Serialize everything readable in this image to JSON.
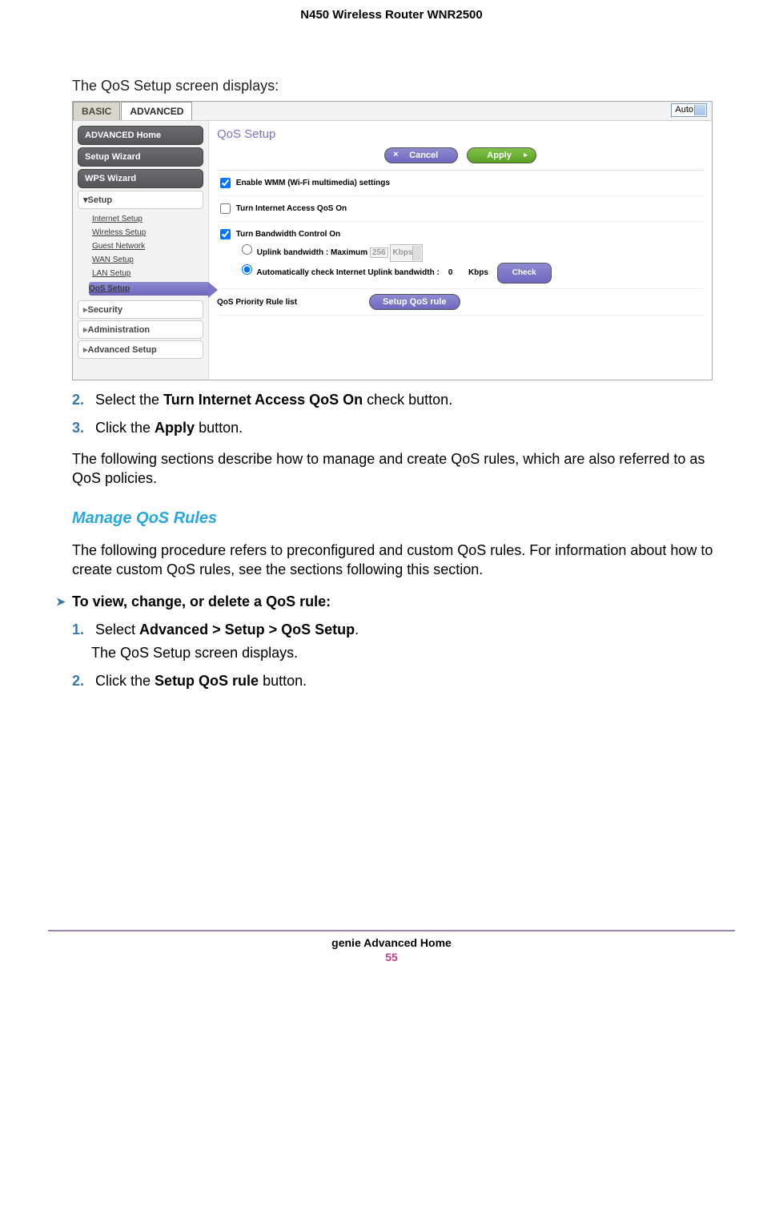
{
  "doc_header": "N450 Wireless Router WNR2500",
  "intro": "The QoS Setup screen displays:",
  "shot": {
    "tabs": {
      "basic": "BASIC",
      "advanced": "ADVANCED"
    },
    "auto_dd": "Auto",
    "sidebar": {
      "adv_home": "ADVANCED Home",
      "setup_wiz": "Setup Wizard",
      "wps_wiz": "WPS Wizard",
      "setup": "Setup",
      "sub": {
        "internet": "Internet Setup",
        "wireless": "Wireless Setup",
        "guest": "Guest Network",
        "wan": "WAN Setup",
        "lan": "LAN Setup",
        "qos": "QoS Setup"
      },
      "security": "Security",
      "admin": "Administration",
      "advsetup": "Advanced Setup"
    },
    "content": {
      "title": "QoS Setup",
      "cancel": "Cancel",
      "apply": "Apply",
      "wmm": "Enable WMM (Wi-Fi multimedia) settings",
      "internet_qos": "Turn Internet Access QoS On",
      "bw_ctrl": "Turn Bandwidth Control On",
      "uplink_label": "Uplink bandwidth :   Maximum",
      "uplink_val": "256",
      "uplink_unit": "Kbps",
      "auto_check_label": "Automatically check Internet Uplink bandwidth :",
      "auto_check_val": "0",
      "auto_check_unit": "Kbps",
      "check_btn": "Check",
      "rule_list": "QoS Priority Rule list",
      "setup_rule_btn": "Setup QoS rule"
    }
  },
  "steps_a": {
    "n2_pre": "Select the ",
    "n2_bold": "Turn Internet Access QoS On",
    "n2_post": " check button.",
    "n3_pre": "Click the ",
    "n3_bold": "Apply",
    "n3_post": " button."
  },
  "para1": "The following sections describe how to manage and create QoS rules, which are also referred to as QoS policies.",
  "h3": "Manage QoS Rules",
  "para2": "The following procedure refers to preconfigured and custom QoS rules. For information about how to create custom QoS rules, see the sections following this section.",
  "proc_head": "To view, change, or delete a QoS rule:",
  "steps_b": {
    "n1_pre": "Select ",
    "n1_bold": "Advanced > Setup > QoS Setup",
    "n1_post": ".",
    "n1_sub": "The QoS Setup screen displays.",
    "n2_pre": "Click the ",
    "n2_bold": "Setup QoS rule",
    "n2_post": " button."
  },
  "footer": {
    "title": "genie Advanced Home",
    "page": "55"
  }
}
